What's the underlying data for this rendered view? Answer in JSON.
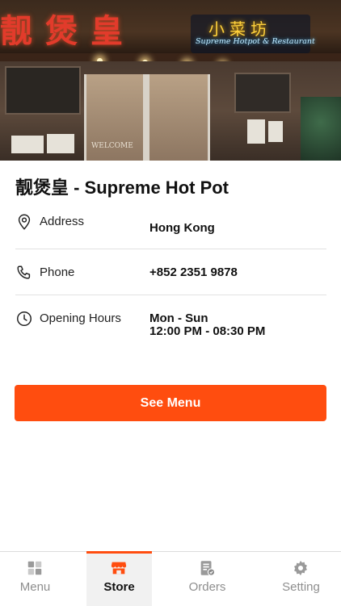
{
  "store": {
    "name": "靓煲皇 - Supreme Hot Pot",
    "sign_cn_main": "靓煲皇",
    "sign_cn_small": "小菜坊",
    "sign_en": "Supreme Hotpot & Restaurant",
    "door_mat": "WELCOME"
  },
  "details": {
    "address_label": "Address",
    "address_value": "Hong Kong",
    "phone_label": "Phone",
    "phone_value": "+852 2351 9878",
    "hours_label": "Opening Hours",
    "hours_days": "Mon - Sun",
    "hours_time": "12:00 PM - 08:30 PM"
  },
  "actions": {
    "see_menu": "See Menu"
  },
  "tabs": [
    {
      "label": "Menu",
      "icon": "grid-icon",
      "active": false
    },
    {
      "label": "Store",
      "icon": "storefront-icon",
      "active": true
    },
    {
      "label": "Orders",
      "icon": "receipt-icon",
      "active": false
    },
    {
      "label": "Setting",
      "icon": "gear-icon",
      "active": false
    }
  ],
  "colors": {
    "accent": "#ff4d0f",
    "tab_inactive": "#8e8e8e",
    "tab_active_bg": "#f1f1f1"
  }
}
